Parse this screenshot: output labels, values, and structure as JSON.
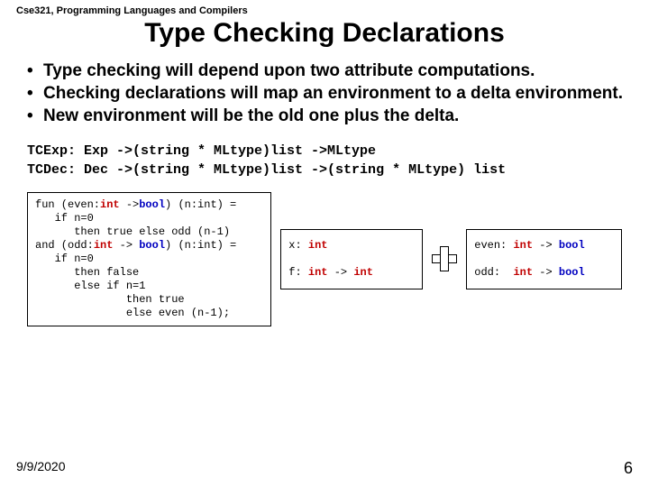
{
  "course": "Cse321, Programming Languages and Compilers",
  "title": "Type Checking Declarations",
  "bullets": [
    "Type checking will depend upon two attribute computations.",
    "Checking declarations will map an environment to a delta  environment.",
    "New environment will be the old one plus the delta."
  ],
  "sig1": "TCExp: Exp ->(string * MLtype)list ->MLtype",
  "sig2": "TCDec: Dec ->(string * MLtype)list ->(string * MLtype) list",
  "code_left": {
    "l1a": "fun (even:",
    "l1b": "int",
    "l1c": " ->",
    "l1d": "bool",
    "l1e": ") (n:int) =",
    "l2": "   if n=0",
    "l3": "      then true else odd (n-1)",
    "l4a": "and (odd:",
    "l4b": "int",
    "l4c": " -> ",
    "l4d": "bool",
    "l4e": ") (n:int) =",
    "l5": "   if n=0",
    "l6": "      then false",
    "l7": "      else if n=1",
    "l8": "              then true",
    "l9": "              else even (n-1);"
  },
  "code_mid": {
    "l1a": "x: ",
    "l1b": "int",
    "l2a": "f: ",
    "l2b": "int",
    "l2c": " -> ",
    "l2d": "int"
  },
  "code_right": {
    "l1a": "even: ",
    "l1b": "int",
    "l1c": " -> ",
    "l1d": "bool",
    "l2a": "odd:  ",
    "l2b": "int",
    "l2c": " -> ",
    "l2d": "bool"
  },
  "footer": {
    "date": "9/9/2020",
    "page": "6"
  }
}
